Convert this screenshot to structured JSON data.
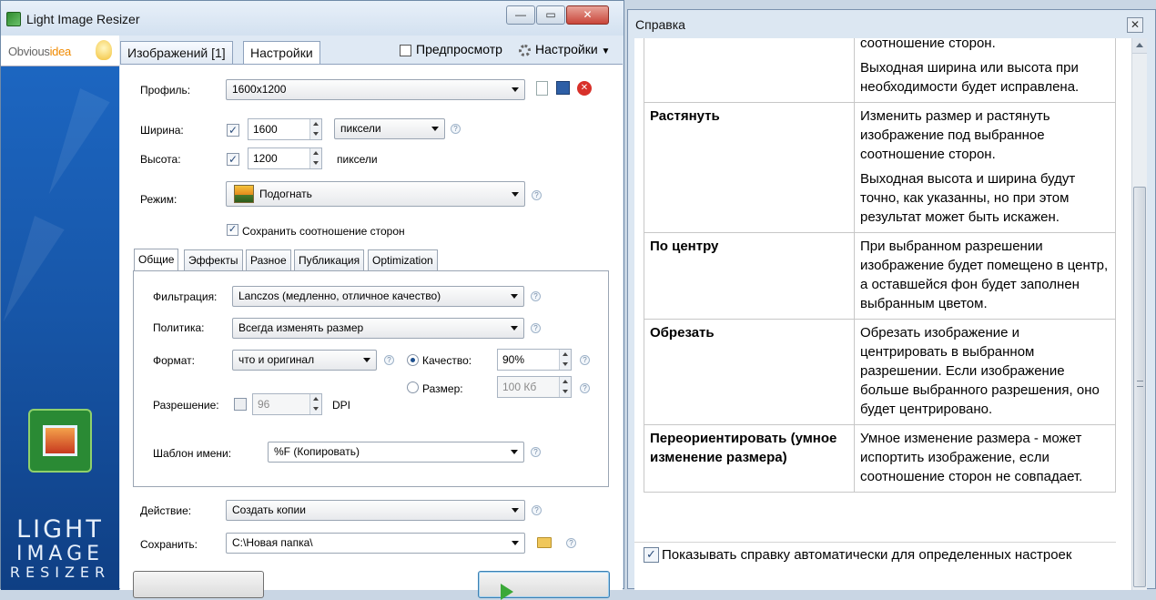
{
  "main_window": {
    "title": "Light Image Resizer",
    "controls": {
      "minimize": "—",
      "maximize": "▭",
      "close": "✕"
    }
  },
  "sidebar": {
    "logo_text_1": "Obvious",
    "logo_text_2": "idea",
    "brand_line_1": "LIGHT",
    "brand_line_2": "IMAGE",
    "brand_line_3": "RESIZER"
  },
  "tabs": {
    "images": "Изображений [1]",
    "settings": "Настройки",
    "preview": "Предпросмотр",
    "settings_menu": "Настройки"
  },
  "form": {
    "profile_label": "Профиль:",
    "profile_value": "1600x1200",
    "width_label": "Ширина:",
    "width_value": "1600",
    "width_checked": true,
    "units_value": "пиксели",
    "height_label": "Высота:",
    "height_value": "1200",
    "height_checked": true,
    "height_units": "пиксели",
    "mode_label": "Режим:",
    "mode_value": "Подогнать",
    "keep_ratio_label": "Сохранить соотношение сторон",
    "keep_ratio_checked": true,
    "help_glyph": "?"
  },
  "inner_tabs": [
    "Общие",
    "Эффекты",
    "Разное",
    "Публикация",
    "Optimization"
  ],
  "general": {
    "filter_label": "Фильтрация:",
    "filter_value": "Lanczos  (медленно, отличное качество)",
    "policy_label": "Политика:",
    "policy_value": "Всегда изменять размер",
    "format_label": "Формат:",
    "format_value": "что и оригинал",
    "quality_label": "Качество:",
    "quality_value": "90%",
    "quality_selected": true,
    "size_label": "Размер:",
    "size_value": "100 Кб",
    "resolution_label": "Разрешение:",
    "resolution_value": "96",
    "resolution_unit": "DPI",
    "name_template_label": "Шаблон имени:",
    "name_template_value": "%F (Копировать)"
  },
  "action": {
    "action_label": "Действие:",
    "action_value": "Создать копии",
    "save_label": "Сохранить:",
    "save_value": "C:\\Новая папка\\"
  },
  "help_window": {
    "title": "Справка",
    "close": "✕",
    "rows": [
      {
        "term": "",
        "paragraphs": [
          "соотношение сторон.",
          "Выходная ширина или высота при необходимости будет исправлена."
        ]
      },
      {
        "term": "Растянуть",
        "paragraphs": [
          "Изменить размер и растянуть изображение под выбранное соотношение сторон.",
          "Выходная высота и ширина будут точно, как указанны, но при этом результат может быть искажен."
        ]
      },
      {
        "term": "По центру",
        "paragraphs": [
          "При выбранном разрешении изображение будет помещено в центр, а оставшейся фон будет заполнен выбранным цветом."
        ]
      },
      {
        "term": "Обрезать",
        "paragraphs": [
          "Обрезать изображение и центрировать в выбранном разрешении. Если изображение больше выбранного разрешения, оно будет центрировано."
        ]
      },
      {
        "term": "Переориентировать (умное изменение размера)",
        "paragraphs": [
          "Умное изменение размера - может испортить изображение, если соотношение сторон не совпадает."
        ]
      }
    ],
    "auto_help_label": "Показывать справку автоматически для определенных настроек",
    "auto_help_checked": true
  }
}
